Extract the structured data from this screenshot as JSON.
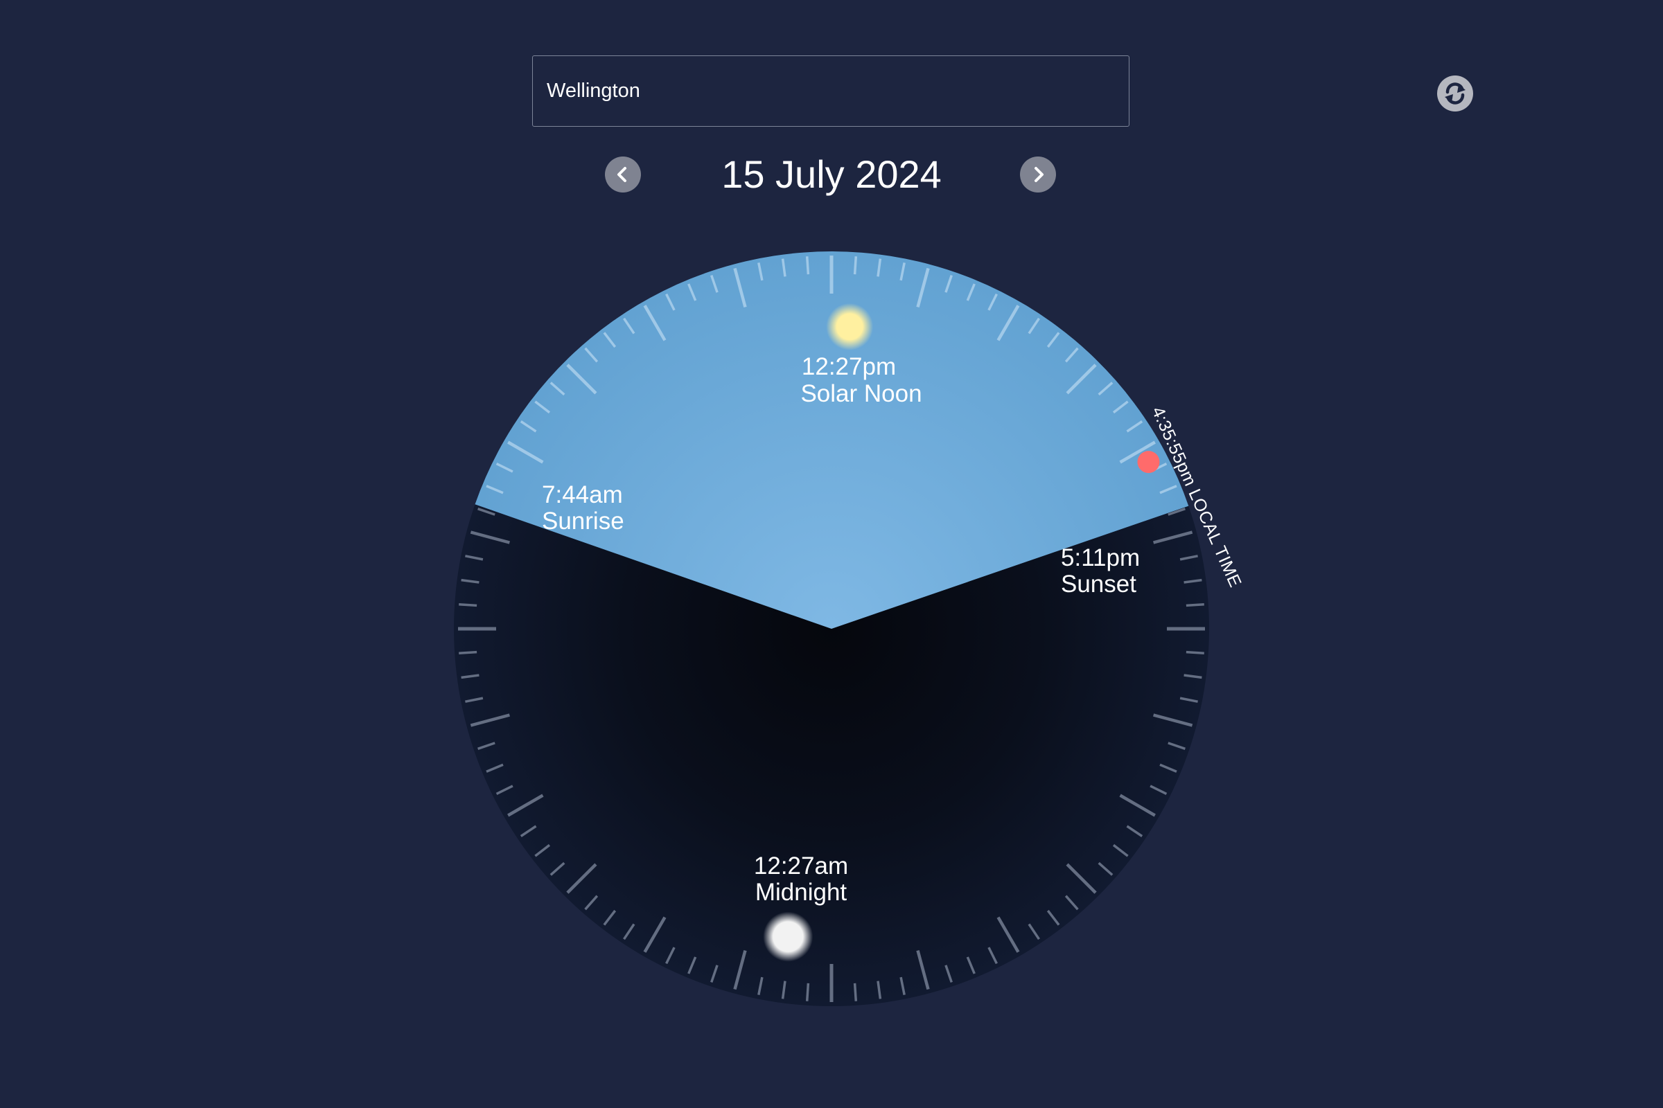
{
  "location": {
    "value": "Wellington",
    "refresh_icon": "refresh-icon"
  },
  "date_nav": {
    "date_label": "15 July 2024",
    "prev_icon": "chevron-left-icon",
    "next_icon": "chevron-right-icon"
  },
  "sun_clock": {
    "sunrise": {
      "time": "7:44am",
      "label": "Sunrise",
      "clock_time": "07:44"
    },
    "solar_noon": {
      "time": "12:27pm",
      "label": "Solar Noon",
      "clock_time": "12:27"
    },
    "sunset": {
      "time": "5:11pm",
      "label": "Sunset",
      "clock_time": "17:11"
    },
    "midnight": {
      "time": "12:27am",
      "label": "Midnight",
      "clock_time": "00:27"
    },
    "current_time": {
      "label": "4:35:55pm LOCAL TIME",
      "clock_time": "16:35:55"
    },
    "colors": {
      "page_background": "#1d2540",
      "day_sky": "#6aa8d6",
      "night_sky": "#0a0f1c",
      "sun": "#fff0a0",
      "moon": "#f2f2f2",
      "current_marker": "#ff6b6b"
    }
  }
}
